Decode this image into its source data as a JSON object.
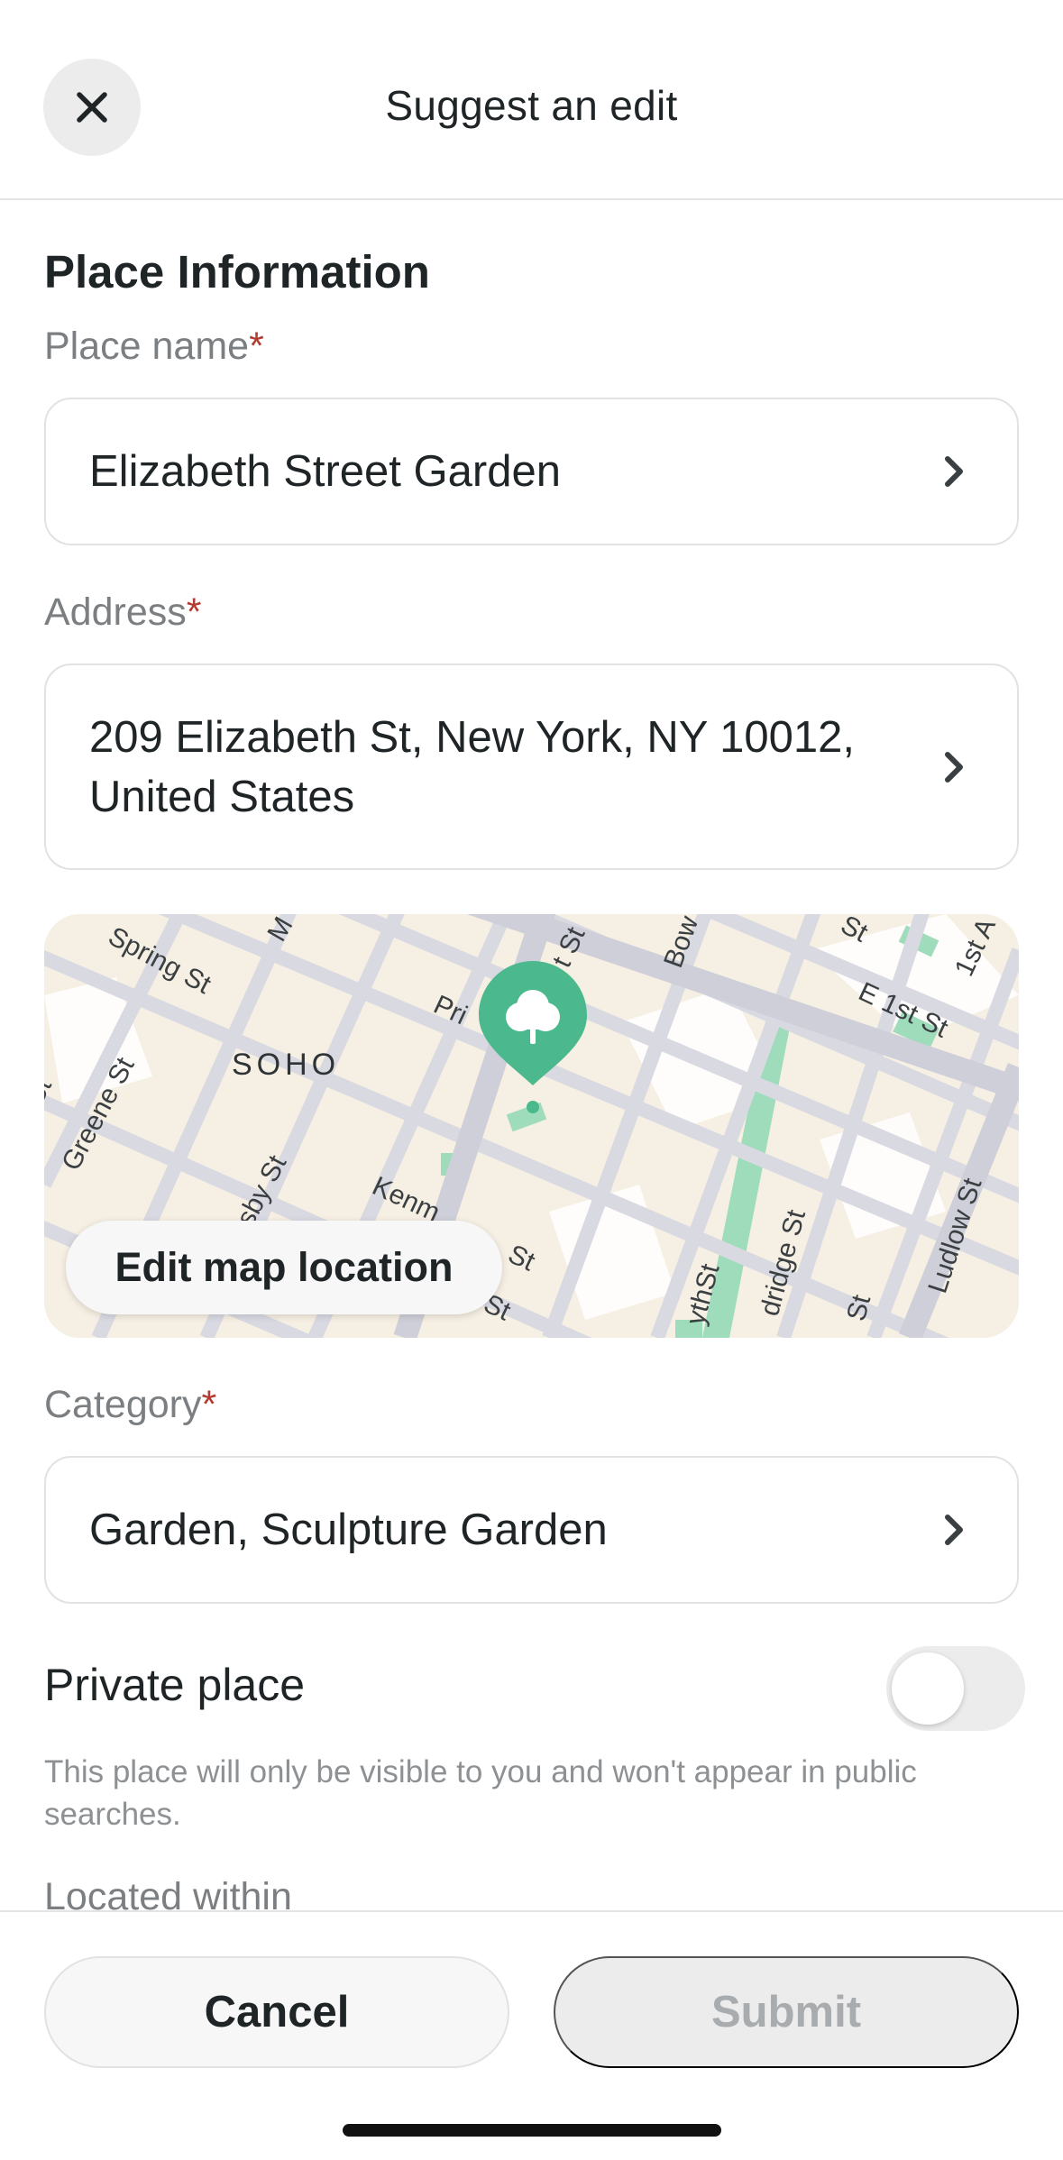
{
  "header": {
    "title": "Suggest an edit"
  },
  "section": {
    "title": "Place Information"
  },
  "fields": {
    "place_name": {
      "label": "Place name",
      "required_mark": "*",
      "value": "Elizabeth Street Garden"
    },
    "address": {
      "label": "Address",
      "required_mark": "*",
      "value_line1": "209 Elizabeth St, New York, NY 10012,",
      "value_line2": "United States"
    },
    "category": {
      "label": "Category",
      "required_mark": "*",
      "value": "Garden, Sculpture Garden"
    }
  },
  "map": {
    "edit_button_label": "Edit map location",
    "neighborhood": "SOHO",
    "street_labels": {
      "spring": "Spring St",
      "greene": "Greene St",
      "crosby": "sby St",
      "kenmare": "Kenm",
      "kenmare_st": "St",
      "prince": "Pri",
      "elizabeth": "t St",
      "bowery": "Bow",
      "e1st": "E 1st St",
      "first_ave": "1st A",
      "first_st": "St",
      "forsyth": "ythSt",
      "eldridge": "dridge St",
      "allen": "St",
      "ludlow": "Ludlow St",
      "mott": "M",
      "delancey": "St",
      "greene_cut": "St"
    },
    "pin_icon": "tree-icon",
    "accent_color": "#4bb98d"
  },
  "private_place": {
    "label": "Private place",
    "enabled": false,
    "help_text": "This place will only be visible to you and won't appear in public searches."
  },
  "next_field_label": "Located within",
  "footer": {
    "cancel_label": "Cancel",
    "submit_label": "Submit"
  }
}
